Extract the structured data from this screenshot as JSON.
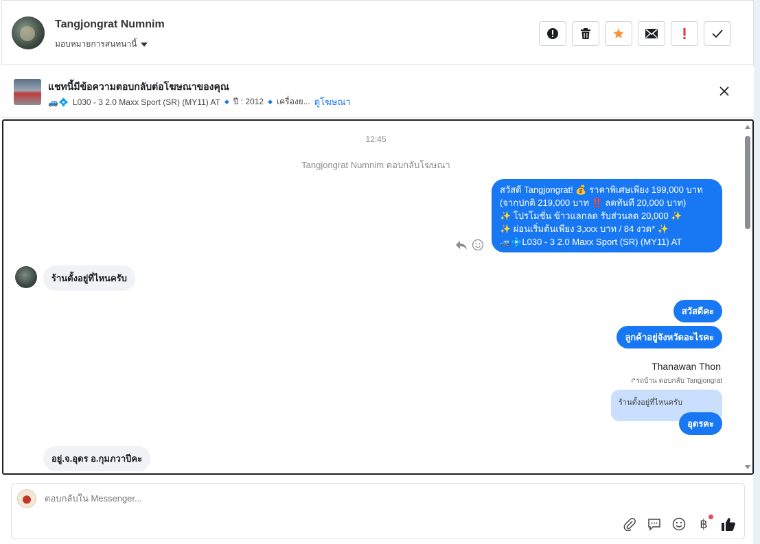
{
  "header": {
    "contact_name": "Tangjongrat Numnim",
    "assign_label": "มอบหมายการสนทนานี้",
    "actions": [
      "mark-spam",
      "delete",
      "star",
      "mark-unread",
      "important",
      "mark-done"
    ]
  },
  "ad_banner": {
    "title": "แชทนี้มีข้อความตอบกลับต่อโฆษณาของคุณ",
    "vehicle_emoji": "🚙💠",
    "model": "L030 - 3 2.0 Maxx Sport (SR) (MY11) AT",
    "year": "ปี : 2012",
    "engine_truncated": "เครื่องย...",
    "view_ad_link": "ดูโฆษณา"
  },
  "chat": {
    "timestamp": "12:45",
    "system_notice": "Tangjongrat Numnim ตอบกลับโฆษณา",
    "ad_reply_lines": [
      "สวัสดี Tangjongrat! 💰 ราคาพิเศษเพียง 199,000 บาท",
      "(จากปกติ 219,000 บาท ‼️ ลดทันที 20,000 บาท)",
      "✨ โปรโมชั่น ข้าวแลกลด รับส่วนลด 20,000 ✨",
      "✨ ผ่อนเริ่มต้นเพียง 3,xxx บาท / 84 งวด* ✨",
      "🚙💠L030 - 3 2.0 Maxx Sport (SR) (MY11) AT"
    ],
    "customer_msg_1": "ร้านตั้งอยู่ที่ไหนครับ",
    "out_msg_1": "สวัสดีคะ",
    "out_msg_2": "ลูกค้าอยู่จังหวัดอะไรคะ",
    "agent_name": "Thanawan Thon",
    "reply_info": "↱รถบ้าน ตอบกลับ Tangjongrat",
    "quoted_text": "ร้านตั้งอยู่ที่ไหนครับ",
    "out_msg_3": "อุดรคะ",
    "customer_msg_2": "อยู่.จ.อุดร อ.กุมภวาปีคะ"
  },
  "composer": {
    "placeholder": "ตอบกลับใน Messenger...",
    "baht_symbol": "฿"
  },
  "colors": {
    "accent": "#1877f2",
    "bubble_in": "#f0f2f5",
    "quote_bg": "#c9dffd",
    "star": "#f7923a",
    "important": "#e03131"
  }
}
